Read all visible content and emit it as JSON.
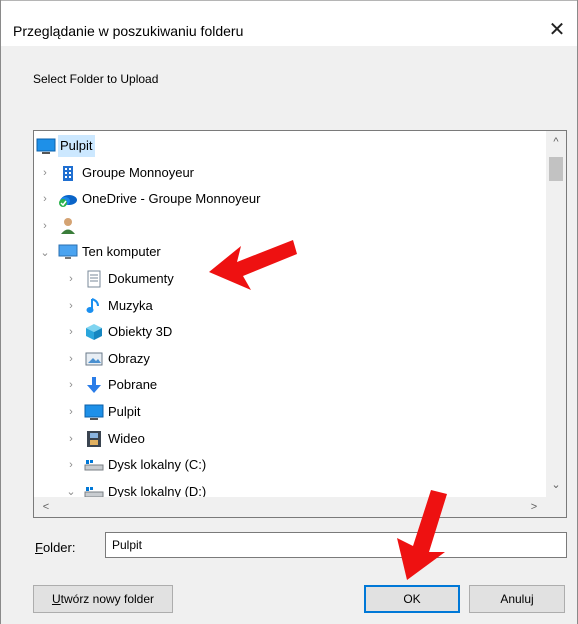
{
  "dialog": {
    "title": "Przeglądanie w poszukiwaniu folderu",
    "prompt": "Select Folder to Upload",
    "close_glyph": "✕"
  },
  "tree": {
    "items": [
      {
        "label": "Pulpit",
        "level": 0,
        "expander": "",
        "icon": "desktop-icon",
        "selected": true
      },
      {
        "label": "Groupe Monnoyeur",
        "level": 1,
        "expander": "›",
        "icon": "building-icon"
      },
      {
        "label": "OneDrive - Groupe Monnoyeur",
        "level": 1,
        "expander": "›",
        "icon": "onedrive-cloud-icon"
      },
      {
        "label": "",
        "level": 1,
        "expander": "›",
        "icon": "user-icon"
      },
      {
        "label": "Ten komputer",
        "level": 1,
        "expander": "⌄",
        "icon": "computer-icon"
      },
      {
        "label": "Dokumenty",
        "level": 2,
        "expander": "›",
        "icon": "documents-icon"
      },
      {
        "label": "Muzyka",
        "level": 2,
        "expander": "›",
        "icon": "music-icon"
      },
      {
        "label": "Obiekty 3D",
        "level": 2,
        "expander": "›",
        "icon": "cube-3d-icon"
      },
      {
        "label": "Obrazy",
        "level": 2,
        "expander": "›",
        "icon": "pictures-icon"
      },
      {
        "label": "Pobrane",
        "level": 2,
        "expander": "›",
        "icon": "download-icon"
      },
      {
        "label": "Pulpit",
        "level": 2,
        "expander": "›",
        "icon": "desktop-icon"
      },
      {
        "label": "Wideo",
        "level": 2,
        "expander": "›",
        "icon": "video-icon"
      },
      {
        "label": "Dysk lokalny (C:)",
        "level": 2,
        "expander": "›",
        "icon": "drive-icon"
      },
      {
        "label": "Dysk lokalny (D:)",
        "level": 2,
        "expander": "⌄",
        "icon": "drive-icon"
      }
    ]
  },
  "scrollbar": {
    "up": "^",
    "down": "⌄",
    "left": "<",
    "right": ">"
  },
  "folder": {
    "label_prefix": "F",
    "label_rest": "older:",
    "value": "Pulpit"
  },
  "buttons": {
    "new_folder_prefix": "U",
    "new_folder_rest": "twórz nowy folder",
    "ok": "OK",
    "cancel": "Anuluj"
  },
  "colors": {
    "selection": "#cce8ff",
    "accent": "#0078d7",
    "annotation_arrow": "#ee1111"
  }
}
